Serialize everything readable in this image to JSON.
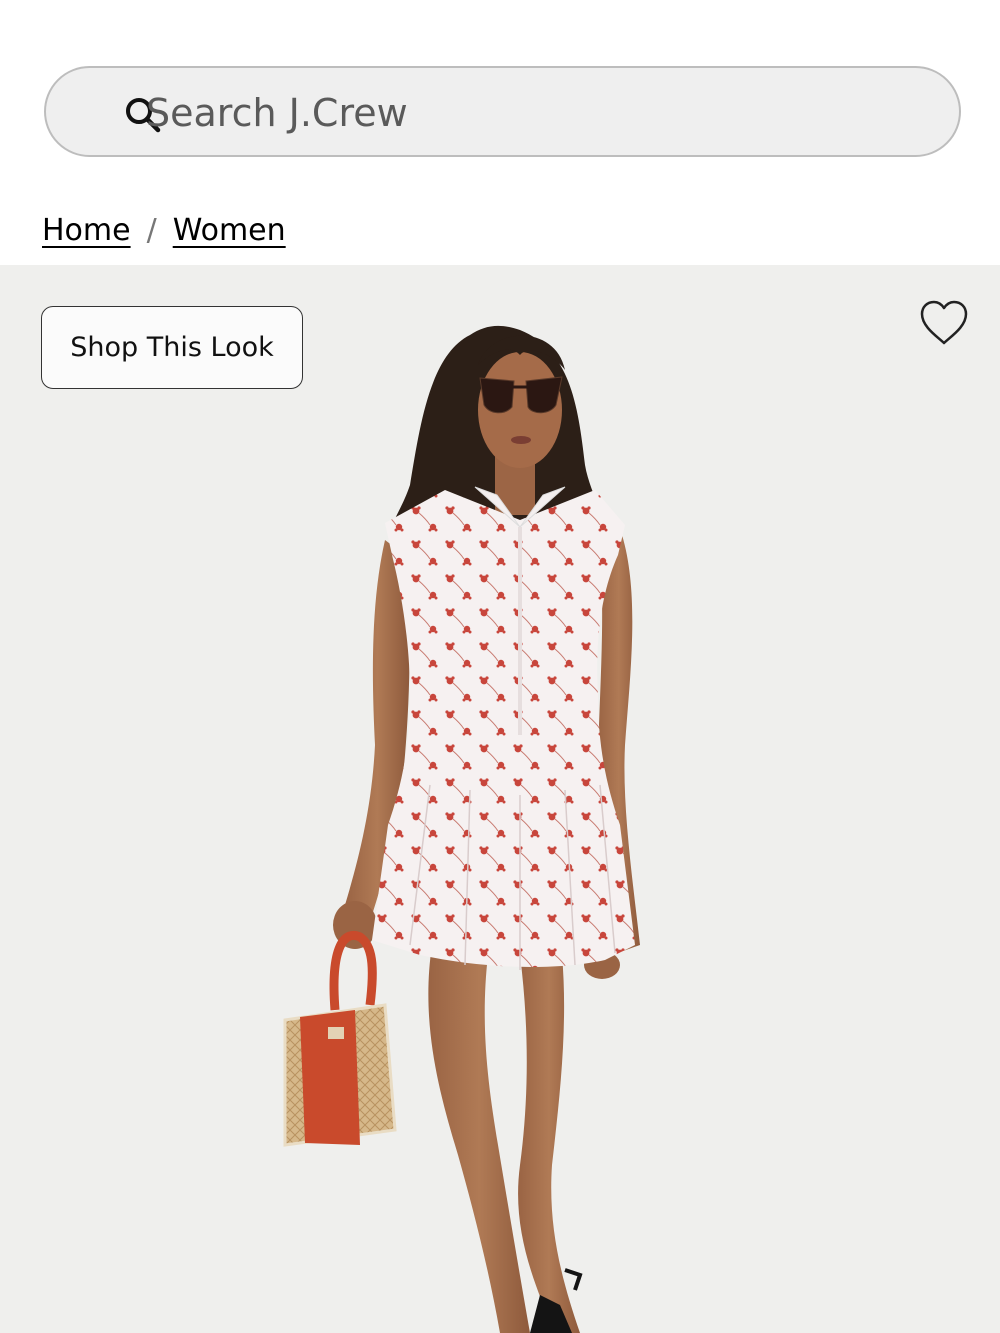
{
  "search": {
    "placeholder": "Search J.Crew",
    "value": ""
  },
  "breadcrumb": {
    "home": "Home",
    "separator": "/",
    "women": "Women"
  },
  "hero": {
    "shop_button": "Shop This Look",
    "wishlist_icon": "heart-outline-icon",
    "image": "model-in-floral-eyelet-mini-dress"
  },
  "colors": {
    "background": "#efefed",
    "dress_accent": "#c8463c",
    "bag": "#c94a2c"
  }
}
